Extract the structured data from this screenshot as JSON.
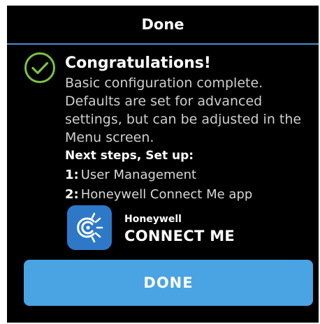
{
  "header": {
    "title": "Done"
  },
  "message": {
    "status_icon": "check-circle-icon",
    "accent_color": "#7cc242",
    "title": "Congratulations!",
    "body": "Basic configuration complete. Defaults are set for advanced settings, but can be adjusted in the Menu screen."
  },
  "next_steps": {
    "heading": "Next steps, Set up:",
    "items": [
      {
        "number": "1:",
        "label": "User Management"
      },
      {
        "number": "2:",
        "label": "Honeywell Connect Me app"
      }
    ]
  },
  "app_badge": {
    "icon": "connect-me-app-icon",
    "brand": "Honeywell",
    "name": "CONNECT ME"
  },
  "done_button": {
    "label": "DONE",
    "color": "#4aa3e3"
  }
}
